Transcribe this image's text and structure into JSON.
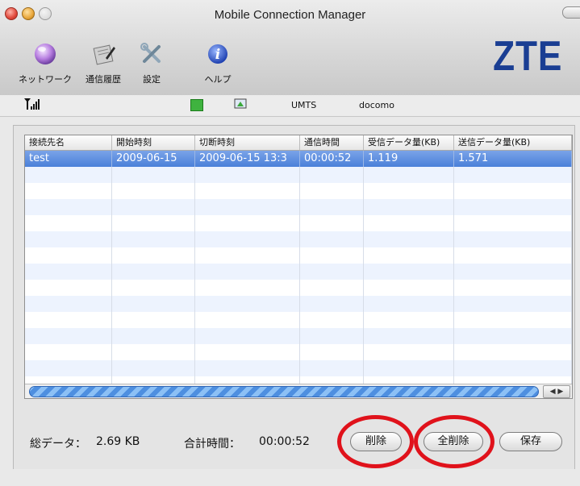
{
  "window": {
    "title": "Mobile Connection Manager"
  },
  "toolbar": {
    "items": [
      {
        "icon": "network-globe-icon",
        "label": "ネットワーク"
      },
      {
        "icon": "history-notepad-icon",
        "label": "通信履歴"
      },
      {
        "icon": "settings-tools-icon",
        "label": "設定"
      },
      {
        "icon": "info-help-icon",
        "label": "ヘルプ"
      }
    ],
    "logo": "ZTE"
  },
  "status": {
    "network_type": "UMTS",
    "operator": "docomo"
  },
  "table": {
    "columns": [
      "接続先名",
      "開始時刻",
      "切断時刻",
      "通信時間",
      "受信データ量(KB)",
      "送信データ量(KB)"
    ],
    "rows": [
      [
        "test",
        "2009-06-15",
        "2009-06-15 13:3",
        "00:00:52",
        "1.119",
        "1.571"
      ]
    ],
    "selected_row": 0
  },
  "footer": {
    "total_data_label": "総データ：",
    "total_data_value": "2.69 KB",
    "total_time_label": "合計時間：",
    "total_time_value": "00:00:52",
    "delete_label": "削除",
    "delete_all_label": "全削除",
    "save_label": "保存"
  },
  "colors": {
    "logo": "#1a3e93",
    "selection": "#4a80d9",
    "highlight_ring": "#e0121b"
  }
}
